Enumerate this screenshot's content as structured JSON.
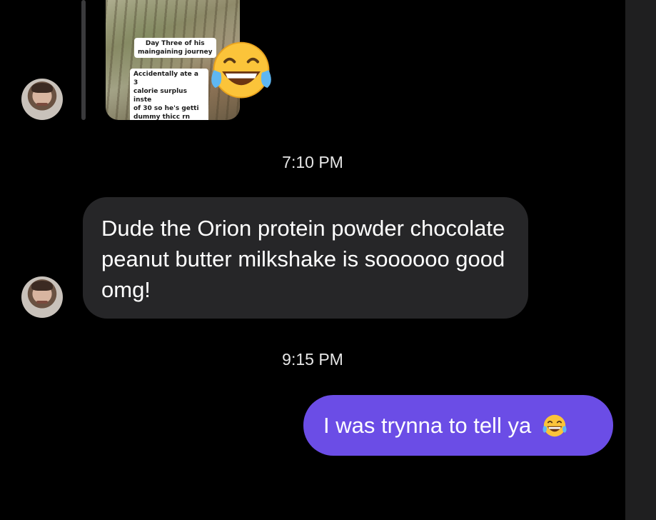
{
  "thread": {
    "shared_post": {
      "caption_1": "Day Three of his\nmaingaining journey",
      "caption_2": "Accidentally ate a 3\ncalorie surplus inste\nof 30 so he's getti\ndummy thicc rn",
      "reaction_emoji": "laughing-tears-emoji"
    },
    "timestamp_1": "7:10 PM",
    "incoming_message": "Dude the Orion protein powder chocolate peanut butter milkshake is soooooo good omg!",
    "timestamp_2": "9:15 PM",
    "outgoing_message": "I was trynna to tell ya",
    "outgoing_emoji": "laughing-tears-emoji"
  },
  "colors": {
    "background": "#000000",
    "incoming_bubble": "#262628",
    "outgoing_bubble": "#6b4de6",
    "timestamp_text": "#e6e6e6"
  }
}
